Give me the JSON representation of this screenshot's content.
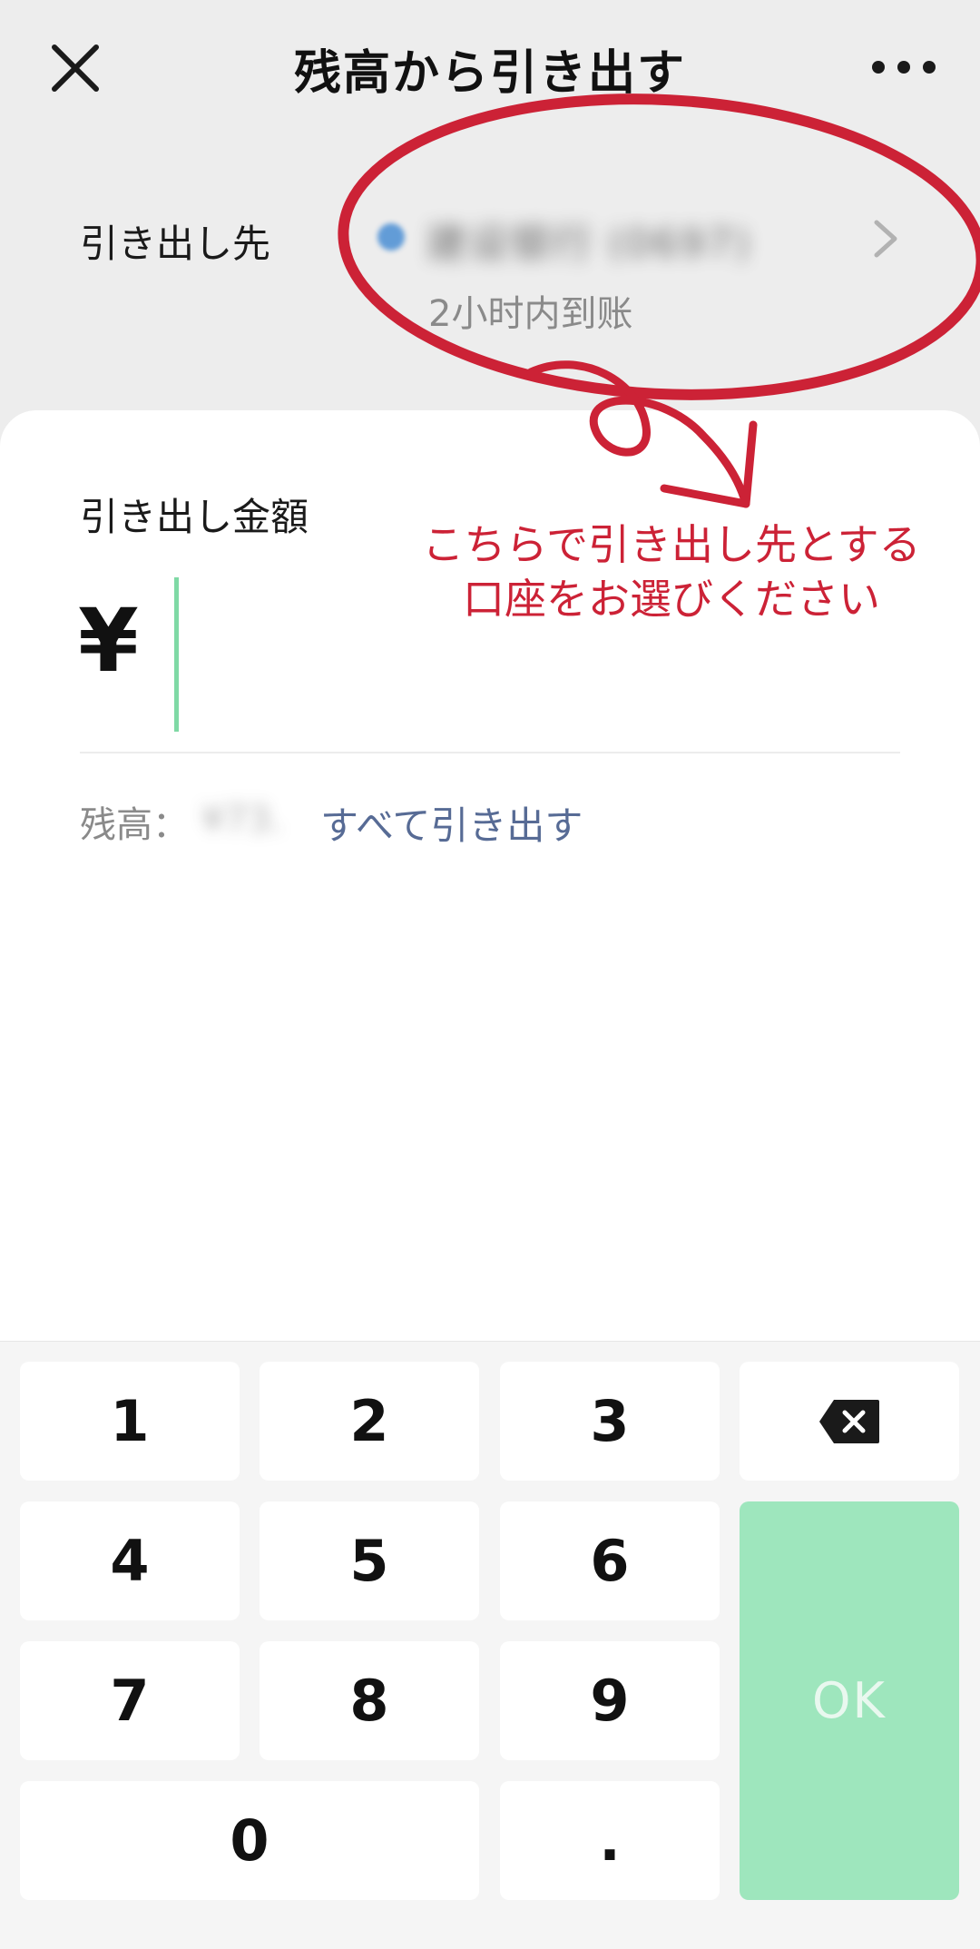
{
  "header": {
    "title": "残高から引き出す",
    "close_icon": "close-icon",
    "more_icon": "more-dots-icon"
  },
  "destination": {
    "label": "引き出し先",
    "bank_name": "建设银行 (0697)",
    "arrival_note": "2小时内到账"
  },
  "amount": {
    "label": "引き出し金額",
    "currency_symbol": "¥",
    "value": ""
  },
  "balance": {
    "label": "残高：",
    "value": "¥73.",
    "withdraw_all_label": "すべて引き出す"
  },
  "annotation": {
    "lines": [
      "こちらで引き出し先とする",
      "口座をお選びください"
    ],
    "color": "#cc2236"
  },
  "keypad": {
    "k1": "1",
    "k2": "2",
    "k3": "3",
    "k4": "4",
    "k5": "5",
    "k6": "6",
    "k7": "7",
    "k8": "8",
    "k9": "9",
    "k0": "0",
    "dot": ".",
    "backspace_icon": "backspace-icon",
    "ok_label": "OK"
  },
  "colors": {
    "accent_green": "#9ee6bd",
    "link_blue": "#576b95",
    "caret_green": "#7fd9a5"
  }
}
